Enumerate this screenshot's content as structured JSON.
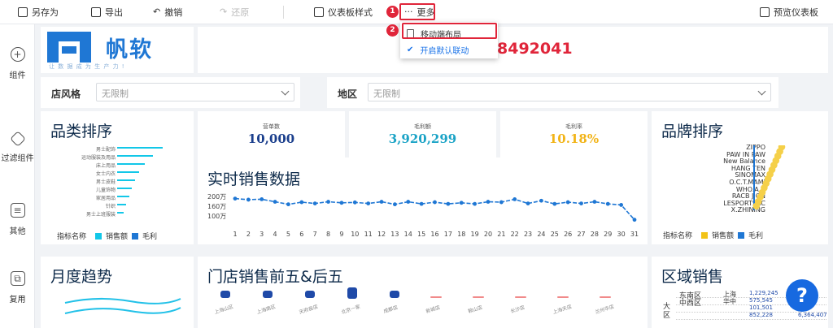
{
  "toolbar": {
    "save_as": "另存为",
    "export": "导出",
    "undo": "撤销",
    "redo": "还原",
    "dashboard_style": "仪表板样式",
    "more": "更多",
    "preview": "预览仪表板"
  },
  "dropdown": {
    "items": [
      {
        "label": "移动端布局",
        "icon": "mobile-icon"
      },
      {
        "label": "开启默认联动",
        "icon": "check-icon"
      }
    ]
  },
  "badges": [
    "1",
    "2"
  ],
  "rail": {
    "items": [
      {
        "label": "组件",
        "icon": "plus-icon"
      },
      {
        "label": "过滤组件",
        "icon": "filter-icon"
      },
      {
        "label": "其他",
        "icon": "document-icon"
      },
      {
        "label": "复用",
        "icon": "copy-icon"
      }
    ]
  },
  "logo": {
    "text": "帆软",
    "slogan": "让 数 据 成 为 生 产 力 !"
  },
  "banner": {
    "number": "8492041"
  },
  "filters": [
    {
      "label": "店风格",
      "placeholder": "无限制"
    },
    {
      "label": "地区",
      "placeholder": "无限制"
    }
  ],
  "kpis": [
    {
      "label": "营单数",
      "value": "10,000",
      "color": "#1a3e8c"
    },
    {
      "label": "毛利额",
      "value": "3,920,299",
      "color": "#1ba3c6"
    },
    {
      "label": "毛利率",
      "value": "10.18%",
      "color": "#f2b418"
    }
  ],
  "category_rank": {
    "title": "品类排序",
    "categories": [
      "男士配饰",
      "运动服装及用品",
      "床上用品",
      "女士内衣",
      "男士皮鞋",
      "儿童饰物",
      "家居用品",
      "针织",
      "男士上班服装"
    ],
    "sales": [
      100,
      78,
      60,
      48,
      40,
      33,
      26,
      20,
      15
    ],
    "profit": [
      0,
      0,
      0,
      0,
      0,
      0,
      0,
      0,
      0
    ],
    "legend": {
      "prefix": "指标名称",
      "items": [
        {
          "name": "销售额",
          "color": "#12c7e8"
        },
        {
          "name": "毛利",
          "color": "#1f77d4"
        }
      ]
    }
  },
  "brand_rank": {
    "title": "品牌排序",
    "brands": [
      "ZIPPO",
      "PAW IN PAW",
      "New Balance",
      "HANG TEN",
      "SINOMAX",
      "O.C.T.MAMI",
      "WHO.A.U",
      "RACB JIQN",
      "LESPORTSAC",
      "X.ZHINING"
    ],
    "legend": {
      "prefix": "指标名称",
      "items": [
        {
          "name": "销售额",
          "color": "#f2c318"
        },
        {
          "name": "毛利",
          "color": "#1f77d4"
        }
      ]
    }
  },
  "realtime": {
    "title": "实时销售数据",
    "y_ticks": [
      "200万",
      "160万",
      "100万"
    ],
    "chart_data": {
      "type": "line",
      "x": [
        "1",
        "2",
        "3",
        "4",
        "5",
        "6",
        "7",
        "8",
        "9",
        "10",
        "11",
        "12",
        "13",
        "14",
        "15",
        "16",
        "17",
        "18",
        "19",
        "20",
        "21",
        "22",
        "23",
        "24",
        "25",
        "26",
        "27",
        "28",
        "29",
        "30",
        "31"
      ],
      "series": [
        {
          "values": [
            195,
            190,
            192,
            180,
            168,
            178,
            172,
            180,
            175,
            177,
            172,
            180,
            168,
            180,
            170,
            178,
            170,
            175,
            170,
            180,
            178,
            192,
            172,
            185,
            170,
            178,
            172,
            180,
            170,
            165,
            95
          ]
        }
      ],
      "ylim": [
        90,
        205
      ]
    }
  },
  "monthly": {
    "title": "月度趋势"
  },
  "stores": {
    "title": "门店销售前五&后五",
    "names": [
      "上海山区",
      "上海南区",
      "天府自店",
      "北京一家",
      "成都店",
      "新城店",
      "鞍山店",
      "长沙店",
      "上海天店",
      "兰州华店"
    ]
  },
  "region": {
    "title": "区域销售",
    "rows": [
      {
        "area": "东南区",
        "city": "上海",
        "v1": "1,229,245",
        "v2": "11"
      },
      {
        "area": "中西区",
        "city": "华中",
        "v1": "575,545",
        "v2": "6,30"
      },
      {
        "area": "",
        "city": "",
        "v1": "101,501",
        "v2": "99"
      },
      {
        "area": "",
        "city": "",
        "v1": "852,228",
        "v2": "6,364,407"
      }
    ],
    "side_label": "大区"
  },
  "help": "?"
}
